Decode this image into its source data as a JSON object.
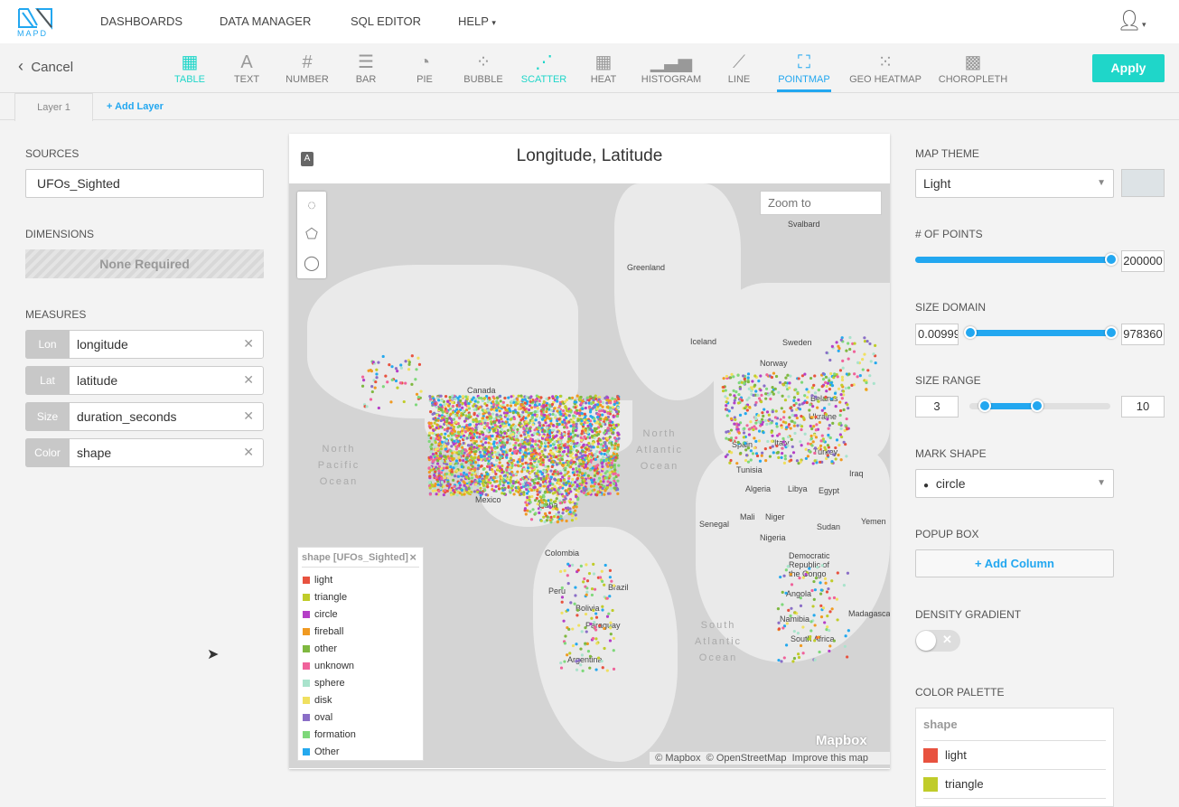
{
  "nav": {
    "logo": "MAPD",
    "items": [
      "DASHBOARDS",
      "DATA MANAGER",
      "SQL EDITOR",
      "HELP"
    ]
  },
  "toolbar": {
    "cancel": "Cancel",
    "apply": "Apply",
    "types": [
      {
        "label": "TABLE",
        "icon": "table-icon"
      },
      {
        "label": "TEXT",
        "icon": "text-icon"
      },
      {
        "label": "NUMBER",
        "icon": "number-icon"
      },
      {
        "label": "BAR",
        "icon": "bar-icon"
      },
      {
        "label": "PIE",
        "icon": "pie-icon"
      },
      {
        "label": "BUBBLE",
        "icon": "bubble-icon"
      },
      {
        "label": "SCATTER",
        "icon": "scatter-icon"
      },
      {
        "label": "HEAT",
        "icon": "heat-icon"
      },
      {
        "label": "HISTOGRAM",
        "icon": "histogram-icon"
      },
      {
        "label": "LINE",
        "icon": "line-icon"
      },
      {
        "label": "POINTMAP",
        "icon": "pointmap-icon"
      },
      {
        "label": "GEO HEATMAP",
        "icon": "geo-heatmap-icon"
      },
      {
        "label": "CHOROPLETH",
        "icon": "choropleth-icon"
      }
    ],
    "active": "POINTMAP"
  },
  "tabs": {
    "layer": "Layer 1",
    "add": "+ Add Layer"
  },
  "left": {
    "sources_label": "SOURCES",
    "source": "UFOs_Sighted",
    "dimensions_label": "DIMENSIONS",
    "dimensions": "None Required",
    "measures_label": "MEASURES",
    "measures": [
      {
        "tag": "Lon",
        "value": "longitude"
      },
      {
        "tag": "Lat",
        "value": "latitude"
      },
      {
        "tag": "Size",
        "value": "duration_seconds"
      },
      {
        "tag": "Color",
        "value": "shape"
      }
    ]
  },
  "chart": {
    "title": "Longitude,  Latitude",
    "zoom_placeholder": "Zoom to",
    "watermark": "Mapbox",
    "attribution": [
      "© Mapbox",
      "© OpenStreetMap",
      "Improve this map"
    ],
    "labels": [
      "Svalbard",
      "Greenland",
      "Iceland",
      "Sweden",
      "Norway",
      "Belarus",
      "Ukraine",
      "Canada",
      "Spain",
      "Italy",
      "Turkey",
      "Tunisia",
      "Iraq",
      "Algeria",
      "Libya",
      "Egypt",
      "Mexico",
      "Cuba",
      "Senegal",
      "Mali",
      "Niger",
      "Sudan",
      "Yemen",
      "Nigeria",
      "Democratic Republic of the Congo",
      "Colombia",
      "Peru",
      "Brazil",
      "Bolivia",
      "Paraguay",
      "Argentina",
      "Angola",
      "Namibia",
      "South Africa",
      "Madagasca"
    ],
    "oceans": [
      "North Pacific Ocean",
      "North Atlantic Ocean",
      "South Atlantic Ocean"
    ]
  },
  "legend": {
    "title": "shape [UFOs_Sighted]",
    "items": [
      {
        "label": "light",
        "color": "#e8523f"
      },
      {
        "label": "triangle",
        "color": "#c0cc2a"
      },
      {
        "label": "circle",
        "color": "#b53fc7"
      },
      {
        "label": "fireball",
        "color": "#f09a22"
      },
      {
        "label": "other",
        "color": "#7fb840"
      },
      {
        "label": "unknown",
        "color": "#f0639b"
      },
      {
        "label": "sphere",
        "color": "#a9e3cc"
      },
      {
        "label": "disk",
        "color": "#f0e060"
      },
      {
        "label": "oval",
        "color": "#8a6ec7"
      },
      {
        "label": "formation",
        "color": "#7ed87a"
      },
      {
        "label": "Other",
        "color": "#25a9ee"
      }
    ]
  },
  "right": {
    "theme_label": "MAP THEME",
    "theme": "Light",
    "points_label": "# OF POINTS",
    "points": "200000",
    "points_fraction": 1.0,
    "domain_label": "SIZE DOMAIN",
    "domain_min": "0.00999",
    "domain_max": "978360",
    "range_label": "SIZE RANGE",
    "range_min": "3",
    "range_max": "10",
    "shape_label": "MARK SHAPE",
    "shape": "circle",
    "popup_label": "POPUP BOX",
    "add_column": "+ Add Column",
    "density_label": "DENSITY GRADIENT",
    "density_on": false,
    "palette_label": "COLOR PALETTE",
    "palette_title": "shape",
    "palette": [
      {
        "label": "light",
        "color": "#e8523f"
      },
      {
        "label": "triangle",
        "color": "#c0cc2a"
      }
    ]
  }
}
